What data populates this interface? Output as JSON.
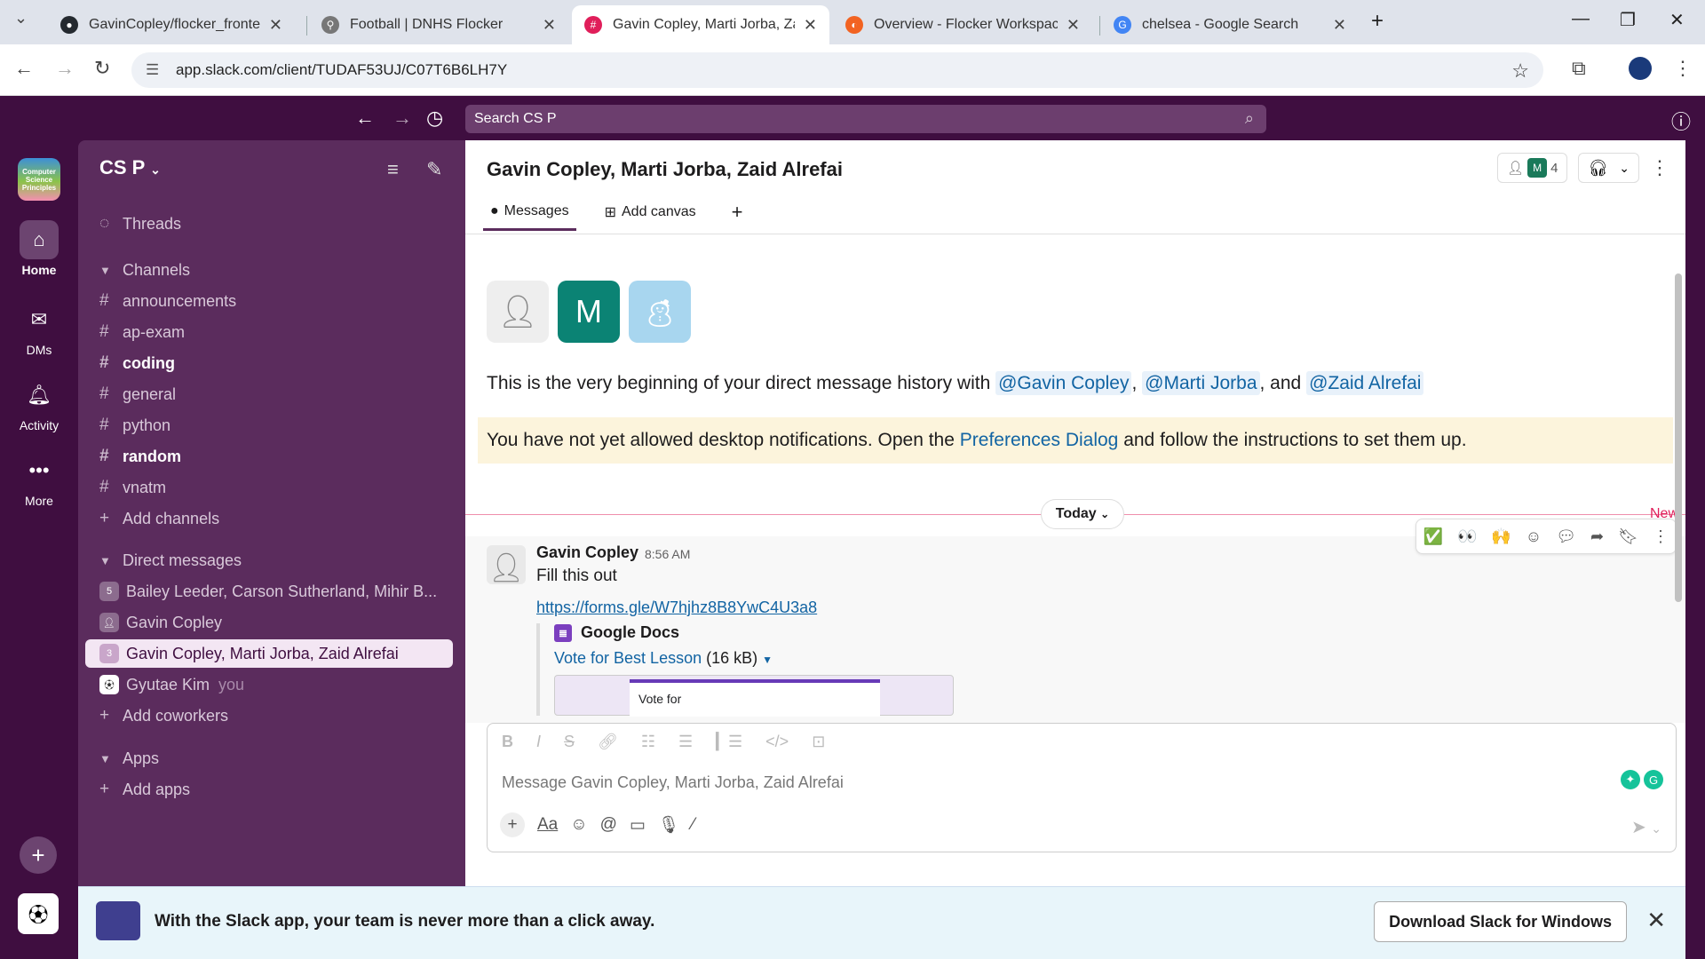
{
  "browser": {
    "tabs": [
      {
        "title": "GavinCopley/flocker_frontend: F",
        "favicon_color": "#24292f"
      },
      {
        "title": "Football | DNHS Flocker",
        "favicon_color": "#555555"
      },
      {
        "title": "Gavin Copley, Marti Jorba, Zaid",
        "favicon_color": "#e01e5a"
      },
      {
        "title": "Overview - Flocker Workspace",
        "favicon_color": "#f26322"
      },
      {
        "title": "chelsea - Google Search",
        "favicon_color": "#4285f4"
      }
    ],
    "url": "app.slack.com/client/TUDAF53UJ/C07T6B6LH7Y"
  },
  "slack": {
    "search_placeholder": "Search CS P",
    "workspace_logo_text": "Computer Science Principles",
    "rail": {
      "home": "Home",
      "dms": "DMs",
      "activity": "Activity",
      "more": "More"
    },
    "sidebar": {
      "workspace_name": "CS P",
      "threads": "Threads",
      "channels_header": "Channels",
      "channels": [
        "announcements",
        "ap-exam",
        "coding",
        "general",
        "python",
        "random",
        "vnatm"
      ],
      "add_channels": "Add channels",
      "dm_header": "Direct messages",
      "dms": [
        {
          "name": "Bailey Leeder, Carson Sutherland, Mihir B...",
          "badge": "5"
        },
        {
          "name": "Gavin Copley",
          "badge": ""
        },
        {
          "name": "Gavin Copley, Marti Jorba, Zaid Alrefai",
          "badge": "3"
        },
        {
          "name": "Gyutae Kim",
          "badge": "",
          "suffix": "you"
        }
      ],
      "add_coworkers": "Add coworkers",
      "apps_header": "Apps",
      "add_apps": "Add apps"
    },
    "channel": {
      "title": "Gavin Copley, Marti Jorba, Zaid Alrefai",
      "member_count": "4",
      "member_initial": "M",
      "tabs": {
        "messages": "Messages",
        "add_canvas": "Add canvas"
      },
      "intro_prefix": "This is the very beginning of your direct message history with ",
      "mentions": [
        "@Gavin Copley",
        "@Marti Jorba",
        "@Zaid Alrefai"
      ],
      "intro_and": ", and ",
      "notif_prefix": "You have not yet allowed desktop notifications. Open the ",
      "notif_link": "Preferences Dialog",
      "notif_suffix": " and follow the instructions to set them up.",
      "divider_label": "Today",
      "new_label": "New"
    },
    "message": {
      "author": "Gavin Copley",
      "time": "8:56 AM",
      "text": "Fill this out",
      "link": "https://forms.gle/W7hjhz8B8YwC4U3a8",
      "attachment_source": "Google Docs",
      "file_name": "Vote for Best Lesson",
      "file_size": "(16 kB)",
      "preview_text": "Vote for"
    },
    "composer": {
      "placeholder": "Message Gavin Copley, Marti Jorba, Zaid Alrefai"
    },
    "banner": {
      "text": "With the Slack app, your team is never more than a click away.",
      "button": "Download Slack for Windows"
    }
  }
}
